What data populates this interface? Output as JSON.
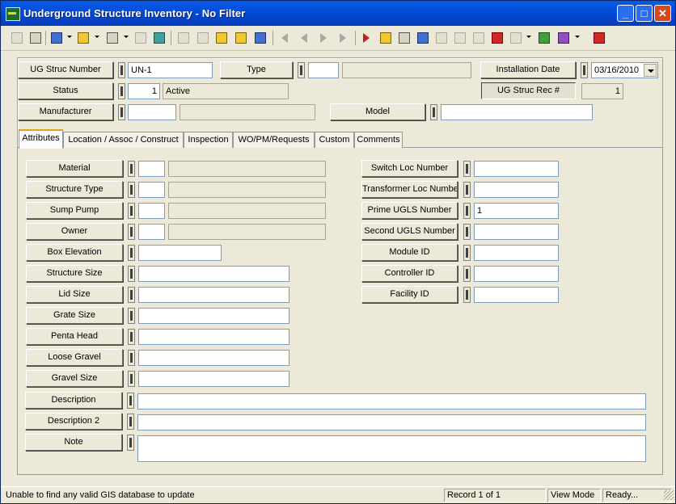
{
  "window": {
    "title": "Underground Structure Inventory - No Filter",
    "minimize": "_",
    "maximize": "□",
    "close": "✕"
  },
  "header": {
    "ug_struc_number": {
      "label": "UG Struc Number",
      "value": "UN-1"
    },
    "type": {
      "label": "Type",
      "code": "",
      "desc": ""
    },
    "installation_date": {
      "label": "Installation Date",
      "value": "03/16/2010"
    },
    "status": {
      "label": "Status",
      "code": "1",
      "desc": "Active"
    },
    "ug_struc_rec": {
      "label": "UG Struc Rec #",
      "value": "1"
    },
    "manufacturer": {
      "label": "Manufacturer",
      "code": "",
      "desc": ""
    },
    "model": {
      "label": "Model",
      "value": ""
    }
  },
  "tabs": [
    "Attributes",
    "Location / Assoc / Construct",
    "Inspection",
    "WO/PM/Requests",
    "Custom",
    "Comments"
  ],
  "attributes": {
    "material": {
      "label": "Material",
      "code": "",
      "desc": ""
    },
    "structure_type": {
      "label": "Structure Type",
      "code": "",
      "desc": ""
    },
    "sump_pump": {
      "label": "Sump Pump",
      "code": "",
      "desc": ""
    },
    "owner": {
      "label": "Owner",
      "code": "",
      "desc": ""
    },
    "box_elevation": {
      "label": "Box Elevation",
      "value": ""
    },
    "structure_size": {
      "label": "Structure Size",
      "value": ""
    },
    "lid_size": {
      "label": "Lid Size",
      "value": ""
    },
    "grate_size": {
      "label": "Grate Size",
      "value": ""
    },
    "penta_head": {
      "label": "Penta Head",
      "value": ""
    },
    "loose_gravel": {
      "label": "Loose Gravel",
      "value": ""
    },
    "gravel_size": {
      "label": "Gravel Size",
      "value": ""
    },
    "description": {
      "label": "Description",
      "value": ""
    },
    "description_2": {
      "label": "Description 2",
      "value": ""
    },
    "note": {
      "label": "Note",
      "value": ""
    },
    "switch_loc_number": {
      "label": "Switch Loc Number",
      "value": ""
    },
    "transformer_loc_number": {
      "label": "Transformer Loc Number",
      "value": ""
    },
    "prime_ugls_number": {
      "label": "Prime UGLS Number",
      "value": "1"
    },
    "second_ugls_number": {
      "label": "Second UGLS Number",
      "value": ""
    },
    "module_id": {
      "label": "Module ID",
      "value": ""
    },
    "controller_id": {
      "label": "Controller ID",
      "value": ""
    },
    "facility_id": {
      "label": "Facility ID",
      "value": ""
    }
  },
  "statusbar": {
    "message": "Unable to find any valid GIS database to update",
    "record": "Record 1 of 1",
    "mode": "View Mode",
    "state": "Ready..."
  }
}
